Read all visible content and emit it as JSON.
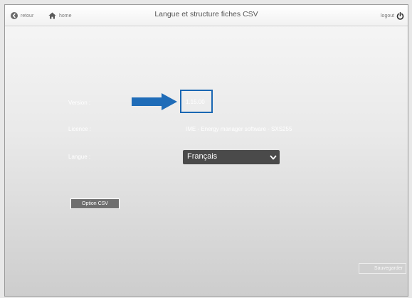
{
  "header": {
    "back_label": "retour",
    "home_label": "home",
    "title": "Langue et structure fiches CSV",
    "logout_label": "logout"
  },
  "form": {
    "version_label": "Version :",
    "version_value": "1.15.00",
    "licence_label": "Licence :",
    "licence_value": "IME - Energy manager software - SXS255",
    "langue_label": "Langue :",
    "langue_value": "Français"
  },
  "buttons": {
    "csv_option_label": "Option CSV",
    "save_label": "Sauvegarder"
  },
  "colors": {
    "annotation_blue": "#1a67b3",
    "select_bg": "#4a4a4a"
  },
  "icons": {
    "back": "back-arrow-circle-icon",
    "home": "home-icon",
    "logout": "power-icon",
    "annotation": "right-arrow-icon",
    "select": "chevron-down-icon"
  }
}
